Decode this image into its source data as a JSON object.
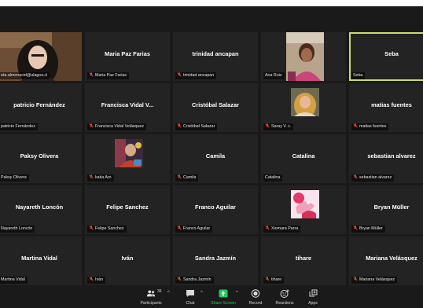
{
  "participants": [
    {
      "name": "",
      "label": "eta.almonacid@ulagos.cl",
      "muted": false,
      "video": "woman-dark-hair"
    },
    {
      "name": "Maria Paz Farias",
      "label": "Maria Paz Farias",
      "muted": true,
      "video": ""
    },
    {
      "name": "trinidad ancapan",
      "label": "trinidad ancapan",
      "muted": true,
      "video": ""
    },
    {
      "name": "",
      "label": "Ana Ruiz",
      "muted": false,
      "video": "woman-pink"
    },
    {
      "name": "Seba",
      "label": "Seba",
      "muted": false,
      "video": "",
      "active": true
    },
    {
      "name": "patricio Fernández",
      "label": "patricio Fernández",
      "muted": false,
      "video": ""
    },
    {
      "name": "Francisca Vidal V...",
      "label": "Francisca Vidal Velásquez",
      "muted": true,
      "video": ""
    },
    {
      "name": "Cristóbal Salazar",
      "label": "Cristóbal Salazar",
      "muted": true,
      "video": ""
    },
    {
      "name": "",
      "label": "Saray V. c.",
      "muted": true,
      "video": "woman-blonde"
    },
    {
      "name": "matias fuentes",
      "label": "matias fuentes",
      "muted": true,
      "video": ""
    },
    {
      "name": "Paksy Olivera",
      "label": "Paksy Olivera",
      "muted": false,
      "video": ""
    },
    {
      "name": "",
      "label": "katia Aro",
      "muted": true,
      "video": "colorful-photo"
    },
    {
      "name": "Camila",
      "label": "Camila",
      "muted": true,
      "video": ""
    },
    {
      "name": "Catalina",
      "label": "Catalina",
      "muted": false,
      "video": ""
    },
    {
      "name": "sebastian alvarez",
      "label": "sebastian alvarez",
      "muted": true,
      "video": ""
    },
    {
      "name": "Nayareth Loncón",
      "label": "Nayareth Loncón",
      "muted": false,
      "video": ""
    },
    {
      "name": "Felipe Sanchez",
      "label": "Felipe Sanchez",
      "muted": true,
      "video": ""
    },
    {
      "name": "Franco Aguilar",
      "label": "Franco Aguilar",
      "muted": true,
      "video": ""
    },
    {
      "name": "",
      "label": "Xiomara Parra",
      "muted": true,
      "video": "pink-avatar"
    },
    {
      "name": "Bryan Müller",
      "label": "Bryan Müller",
      "muted": true,
      "video": ""
    },
    {
      "name": "Martina Vidal",
      "label": "Martina Vidal",
      "muted": false,
      "video": ""
    },
    {
      "name": "Iván",
      "label": "Iván",
      "muted": true,
      "video": ""
    },
    {
      "name": "Sandra Jazmín",
      "label": "Sandra Jazmín",
      "muted": true,
      "video": ""
    },
    {
      "name": "tihare",
      "label": "tihare",
      "muted": true,
      "video": ""
    },
    {
      "name": "Mariana Velásquez",
      "label": "Mariana Velásquez",
      "muted": true,
      "video": ""
    }
  ],
  "toolbar": {
    "participants_label": "Participants",
    "participants_count": "36",
    "chat_label": "Chat",
    "share_label": "Share Screen",
    "record_label": "Record",
    "reactions_label": "Reactions",
    "apps_label": "Apps"
  },
  "colors": {
    "muted_mic": "#e5463f",
    "share_green": "#27c766",
    "active_border": "#c7dd6b"
  }
}
